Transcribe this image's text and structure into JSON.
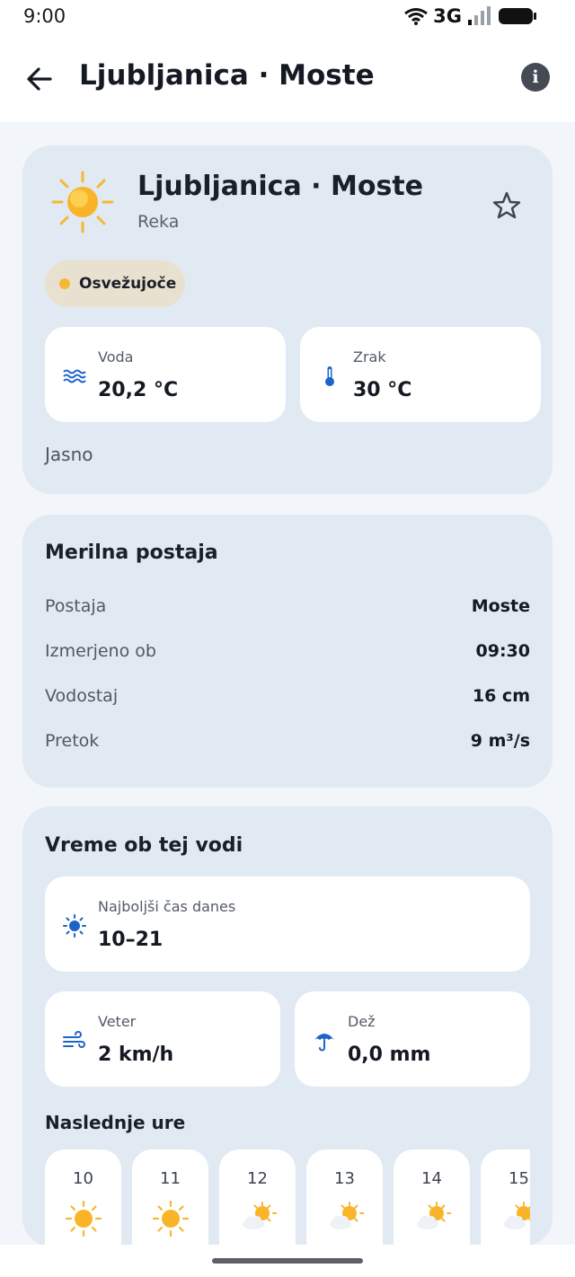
{
  "status_bar": {
    "time": "9:00",
    "network": "3G"
  },
  "app_bar": {
    "title": "Ljubljanica · Moste"
  },
  "hero": {
    "title": "Ljubljanica · Moste",
    "subtitle": "Reka",
    "badge": "Osvežujoče",
    "water_label": "Voda",
    "water_value": "20,2 °C",
    "air_label": "Zrak",
    "air_value": "30 °C",
    "condition": "Jasno"
  },
  "station": {
    "title": "Merilna postaja",
    "rows": [
      {
        "label": "Postaja",
        "value": "Moste"
      },
      {
        "label": "Izmerjeno ob",
        "value": "09:30"
      },
      {
        "label": "Vodostaj",
        "value": "16 cm"
      },
      {
        "label": "Pretok",
        "value": "9 m³/s"
      }
    ]
  },
  "weather": {
    "title": "Vreme ob tej vodi",
    "best_time_label": "Najboljši čas danes",
    "best_time_value": "10–21",
    "wind_label": "Veter",
    "wind_value": "2 km/h",
    "rain_label": "Dež",
    "rain_value": "0,0 mm",
    "next_hours_title": "Naslednje ure",
    "hours": [
      {
        "hour": "10",
        "icon": "sunny-icon"
      },
      {
        "hour": "11",
        "icon": "sunny-icon"
      },
      {
        "hour": "12",
        "icon": "partly-cloudy-icon"
      },
      {
        "hour": "13",
        "icon": "partly-cloudy-icon"
      },
      {
        "hour": "14",
        "icon": "partly-cloudy-icon"
      },
      {
        "hour": "15",
        "icon": "partly-cloudy-icon"
      }
    ]
  },
  "colors": {
    "accent_blue": "#1e63c8",
    "sun": "#f7b733",
    "card": "#e1e9f3",
    "badge_dot": "#f5b73b"
  }
}
